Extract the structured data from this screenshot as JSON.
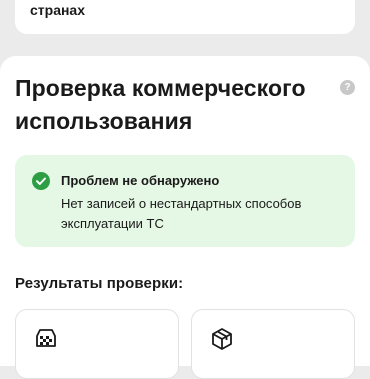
{
  "top_card": {
    "text": "странах"
  },
  "section": {
    "title": "Проверка коммерческого использования",
    "help_icon": "question-icon",
    "help_glyph": "?"
  },
  "status": {
    "icon": "check-circle-icon",
    "title": "Проблем не обнаружено",
    "description": "Нет записей о нестандартных способов эксплуатации ТС",
    "color": "#2e9e44",
    "background": "#e5f7e5"
  },
  "results": {
    "label": "Результаты проверки:",
    "cards": [
      {
        "icon": "taxi-icon"
      },
      {
        "icon": "box-icon"
      }
    ]
  }
}
